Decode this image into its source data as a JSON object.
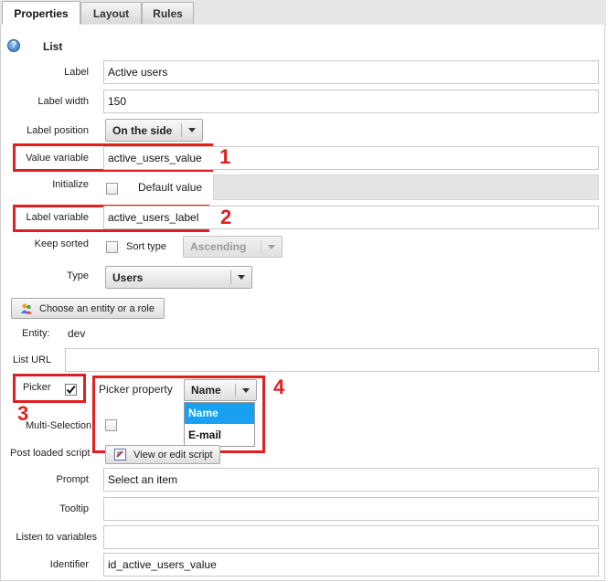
{
  "tabs": [
    {
      "label": "Properties",
      "active": true
    },
    {
      "label": "Layout",
      "active": false
    },
    {
      "label": "Rules",
      "active": false
    }
  ],
  "section": {
    "title": "List",
    "icon": "help-icon"
  },
  "form": {
    "label": {
      "label": "Label",
      "value": "Active users"
    },
    "label_width": {
      "label": "Label width",
      "value": "150"
    },
    "label_position": {
      "label": "Label position",
      "value": "On the side"
    },
    "value_variable": {
      "label": "Value variable",
      "value": "active_users_value"
    },
    "initialize": {
      "label": "Initialize",
      "checkbox_label": "Default value"
    },
    "label_variable": {
      "label": "Label variable",
      "value": "active_users_label"
    },
    "keep_sorted": {
      "label": "Keep sorted",
      "sort_type_label": "Sort type",
      "sort_type_value": "Ascending"
    },
    "type": {
      "label": "Type",
      "value": "Users"
    },
    "choose_entity_button": "Choose an entity or a role",
    "entity": {
      "label": "Entity:",
      "value": "dev"
    },
    "list_url": {
      "label": "List URL",
      "value": ""
    },
    "picker": {
      "label": "Picker",
      "checked": true
    },
    "picker_property": {
      "label": "Picker property",
      "value": "Name",
      "options": [
        "Name",
        "E-mail"
      ],
      "selected_index": 0
    },
    "multi_selection": {
      "label": "Multi-Selection"
    },
    "post_loaded_script": {
      "label": "Post loaded script",
      "button": "View or edit script"
    },
    "prompt": {
      "label": "Prompt",
      "value": "Select an item"
    },
    "tooltip": {
      "label": "Tooltip",
      "value": ""
    },
    "listen_to_variables": {
      "label": "Listen to variables",
      "value": ""
    },
    "identifier": {
      "label": "Identifier",
      "value": "id_active_users_value"
    }
  },
  "annotations": [
    "1",
    "2",
    "3",
    "4"
  ],
  "colors": {
    "annotation": "#e02020",
    "selected_option_bg": "#1aa0f0"
  }
}
